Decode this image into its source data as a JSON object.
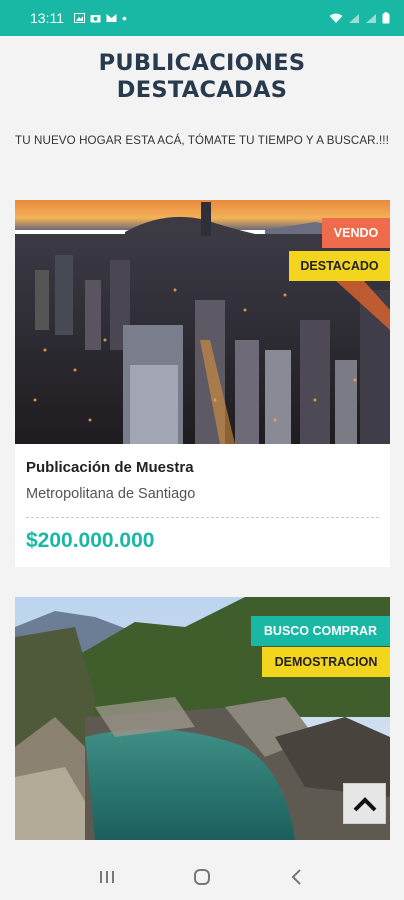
{
  "status_bar": {
    "time": "13:11",
    "dot": "•",
    "left_icons": [
      "image-icon",
      "camera-icon",
      "mail-icon"
    ],
    "right_icons": [
      "wifi-icon",
      "signal-icon",
      "signal-icon",
      "battery-icon"
    ]
  },
  "page": {
    "title_line1": "PUBLICACIONES",
    "title_line2": "DESTACADAS",
    "subtitle": "TU NUEVO HOGAR ESTA ACÁ, TÓMATE TU TIEMPO Y A BUSCAR.!!!"
  },
  "listings": [
    {
      "badges": [
        "VENDO",
        "DESTACADO"
      ],
      "title": "Publicación de Muestra",
      "region": "Metropolitana de Santiago",
      "price": "$200.000.000"
    },
    {
      "badges": [
        "BUSCO COMPRAR",
        "DEMOSTRACION"
      ]
    }
  ],
  "colors": {
    "accent": "#19b8a5",
    "title": "#283a4d",
    "badge_orange": "#ef6b4b",
    "badge_yellow": "#f4d51e"
  },
  "nav": {
    "icons": [
      "recent-apps-icon",
      "home-icon",
      "back-icon"
    ]
  }
}
